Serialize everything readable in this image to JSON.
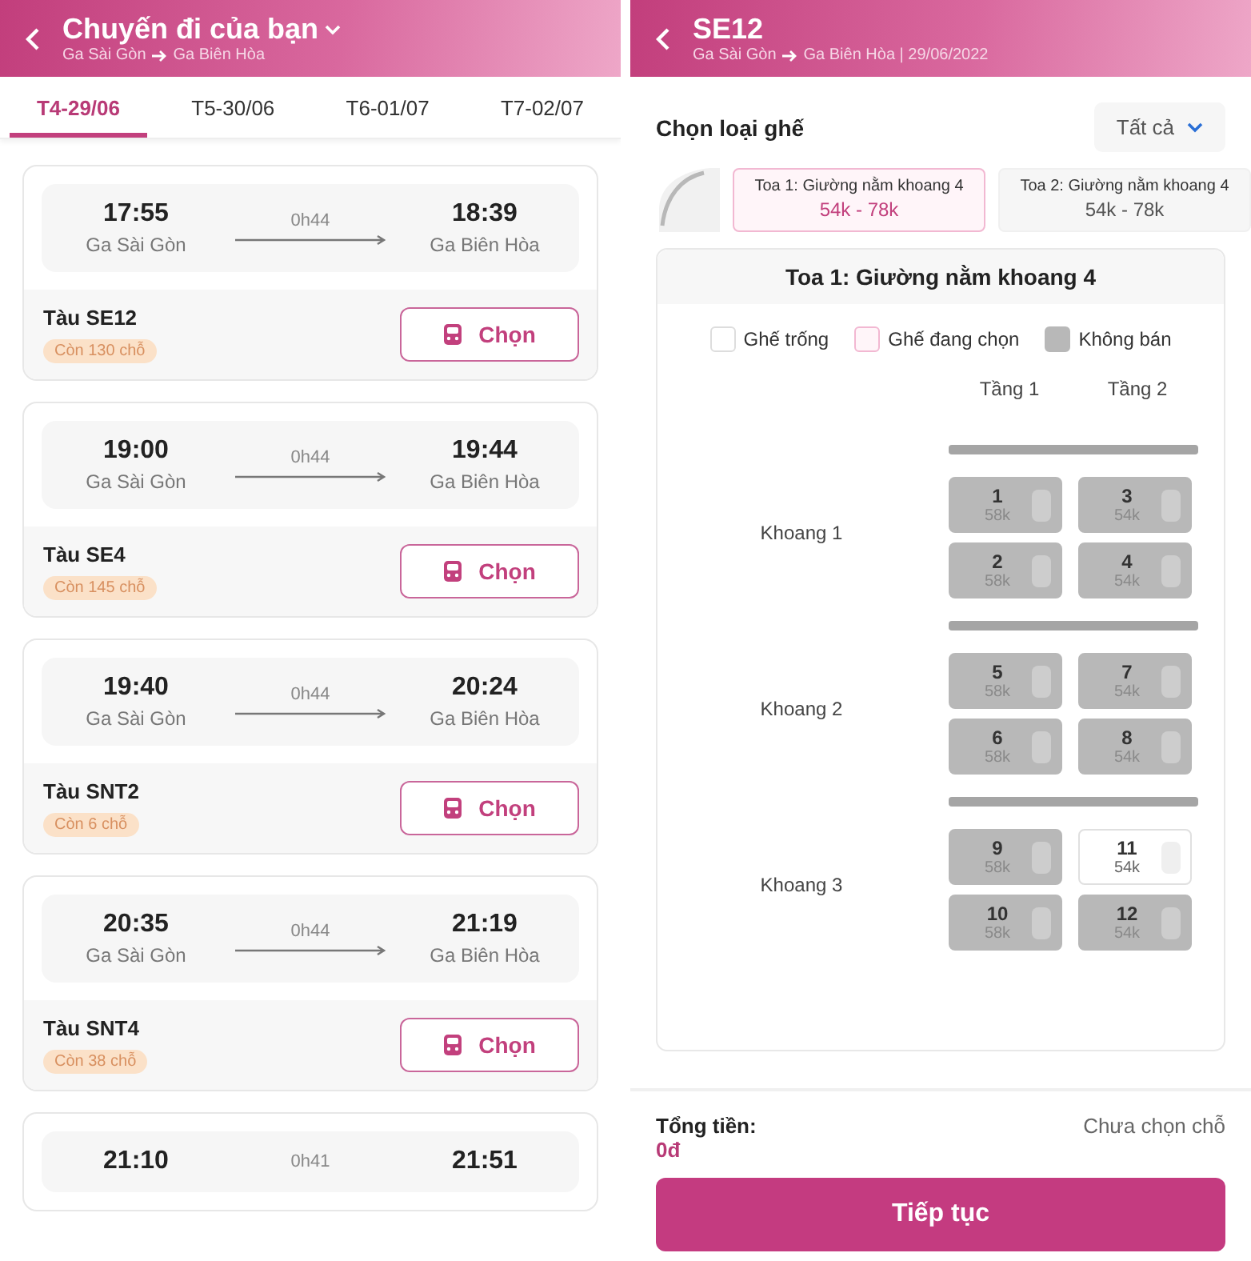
{
  "left": {
    "header": {
      "title": "Chuyến đi của bạn",
      "from": "Ga Sài Gòn",
      "to": "Ga Biên Hòa"
    },
    "tabs": [
      {
        "label": "T4-29/06",
        "selected": true
      },
      {
        "label": "T5-30/06",
        "selected": false
      },
      {
        "label": "T6-01/07",
        "selected": false
      },
      {
        "label": "T7-02/07",
        "selected": false
      }
    ],
    "trips": [
      {
        "depart": "17:55",
        "arrive": "18:39",
        "duration": "0h44",
        "from": "Ga Sài Gòn",
        "to": "Ga Biên Hòa",
        "train": "Tàu SE12",
        "seats_left": "Còn 130 chỗ",
        "action": "Chọn"
      },
      {
        "depart": "19:00",
        "arrive": "19:44",
        "duration": "0h44",
        "from": "Ga Sài Gòn",
        "to": "Ga Biên Hòa",
        "train": "Tàu SE4",
        "seats_left": "Còn 145 chỗ",
        "action": "Chọn"
      },
      {
        "depart": "19:40",
        "arrive": "20:24",
        "duration": "0h44",
        "from": "Ga Sài Gòn",
        "to": "Ga Biên Hòa",
        "train": "Tàu SNT2",
        "seats_left": "Còn 6 chỗ",
        "action": "Chọn"
      },
      {
        "depart": "20:35",
        "arrive": "21:19",
        "duration": "0h44",
        "from": "Ga Sài Gòn",
        "to": "Ga Biên Hòa",
        "train": "Tàu SNT4",
        "seats_left": "Còn 38 chỗ",
        "action": "Chọn"
      },
      {
        "depart": "21:10",
        "arrive": "21:51",
        "duration": "0h41"
      }
    ]
  },
  "right": {
    "header": {
      "title": "SE12",
      "from": "Ga Sài Gòn",
      "to": "Ga Biên Hòa | 29/06/2022"
    },
    "section_title": "Chọn loại ghế",
    "filter": "Tất cả",
    "cars": [
      {
        "name": "Toa 1: Giường nằm khoang 4",
        "price": "54k - 78k",
        "selected": true
      },
      {
        "name": "Toa 2: Giường nằm khoang 4",
        "price": "54k - 78k",
        "selected": false
      }
    ],
    "map": {
      "title": "Toa 1: Giường nằm khoang 4",
      "legend": [
        {
          "kind": "free",
          "label": "Ghế trống"
        },
        {
          "kind": "selected",
          "label": "Ghế đang chọn"
        },
        {
          "kind": "sold",
          "label": "Không bán"
        }
      ],
      "tiers": [
        "Tầng 1",
        "Tầng 2"
      ],
      "compartments": [
        {
          "label": "Khoang 1",
          "seats": [
            {
              "number": "1",
              "price": "58k",
              "disabled": true
            },
            {
              "number": "3",
              "price": "54k",
              "disabled": true
            },
            {
              "number": "2",
              "price": "58k",
              "disabled": true
            },
            {
              "number": "4",
              "price": "54k",
              "disabled": true
            }
          ]
        },
        {
          "label": "Khoang 2",
          "seats": [
            {
              "number": "5",
              "price": "58k",
              "disabled": true
            },
            {
              "number": "7",
              "price": "54k",
              "disabled": true
            },
            {
              "number": "6",
              "price": "58k",
              "disabled": true
            },
            {
              "number": "8",
              "price": "54k",
              "disabled": true
            }
          ]
        },
        {
          "label": "Khoang 3",
          "seats": [
            {
              "number": "9",
              "price": "58k",
              "disabled": true
            },
            {
              "number": "11",
              "price": "54k",
              "disabled": false
            },
            {
              "number": "10",
              "price": "58k",
              "disabled": true
            },
            {
              "number": "12",
              "price": "54k",
              "disabled": true
            }
          ]
        }
      ]
    },
    "total_label": "Tổng tiền:",
    "total": "0đ",
    "seat_status": "Chưa chọn chỗ",
    "continue": "Tiếp tục"
  }
}
